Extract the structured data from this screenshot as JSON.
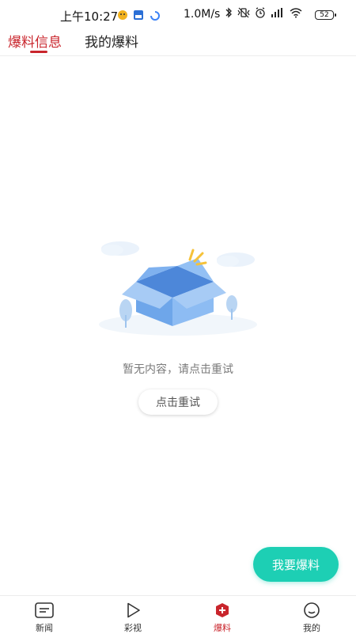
{
  "status_bar": {
    "time": "上午10:27",
    "network_speed": "1.0M/s",
    "battery": "52"
  },
  "tabs": [
    {
      "label": "爆料信息",
      "active": true
    },
    {
      "label": "我的爆料",
      "active": false
    }
  ],
  "empty_state": {
    "message": "暂无内容，请点击重试",
    "retry_label": "点击重试"
  },
  "fab": {
    "label": "我要爆料"
  },
  "bottom_nav": [
    {
      "label": "新闻",
      "icon": "news-icon",
      "active": false
    },
    {
      "label": "彩视",
      "icon": "play-icon",
      "active": false
    },
    {
      "label": "爆料",
      "icon": "report-icon",
      "active": true
    },
    {
      "label": "我的",
      "icon": "profile-icon",
      "active": false
    }
  ],
  "colors": {
    "accent_red": "#c9252c",
    "fab_teal": "#1dcfb4"
  }
}
